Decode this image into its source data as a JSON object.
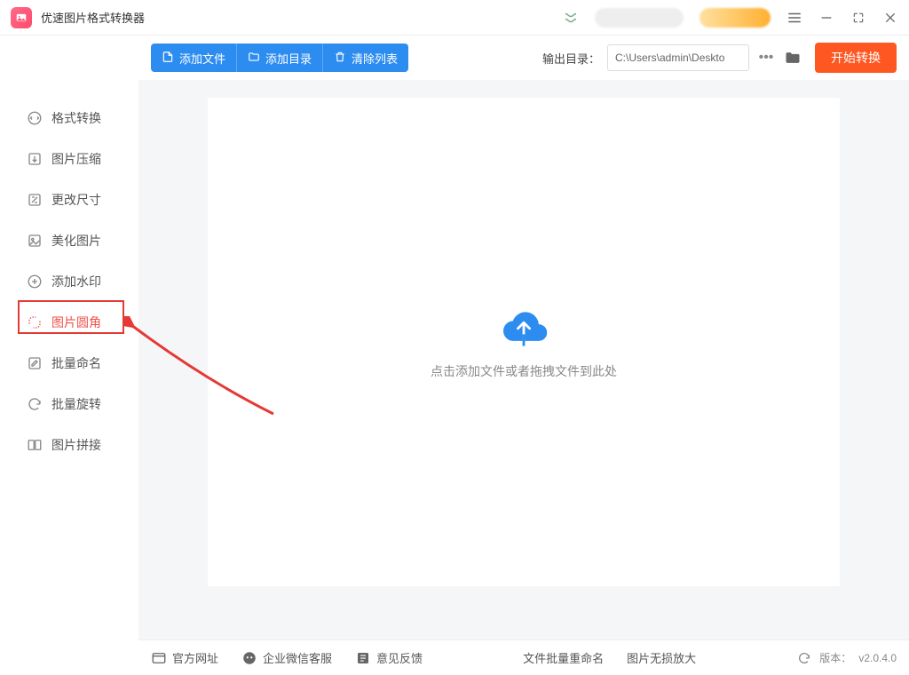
{
  "titlebar": {
    "app_name": "优速图片格式转换器"
  },
  "sidebar": {
    "items": [
      {
        "label": "格式转换"
      },
      {
        "label": "图片压缩"
      },
      {
        "label": "更改尺寸"
      },
      {
        "label": "美化图片"
      },
      {
        "label": "添加水印"
      },
      {
        "label": "图片圆角"
      },
      {
        "label": "批量命名"
      },
      {
        "label": "批量旋转"
      },
      {
        "label": "图片拼接"
      }
    ]
  },
  "toolbar": {
    "add_file": "添加文件",
    "add_folder": "添加目录",
    "clear_list": "清除列表",
    "output_label": "输出目录：",
    "output_path": "C:\\Users\\admin\\Deskto",
    "start": "开始转换"
  },
  "drop": {
    "hint": "点击添加文件或者拖拽文件到此处"
  },
  "footer": {
    "official_site": "官方网址",
    "wechat_support": "企业微信客服",
    "feedback": "意见反馈",
    "batch_rename": "文件批量重命名",
    "lossless_zoom": "图片无损放大",
    "version_label": "版本：",
    "version_value": "v2.0.4.0"
  }
}
